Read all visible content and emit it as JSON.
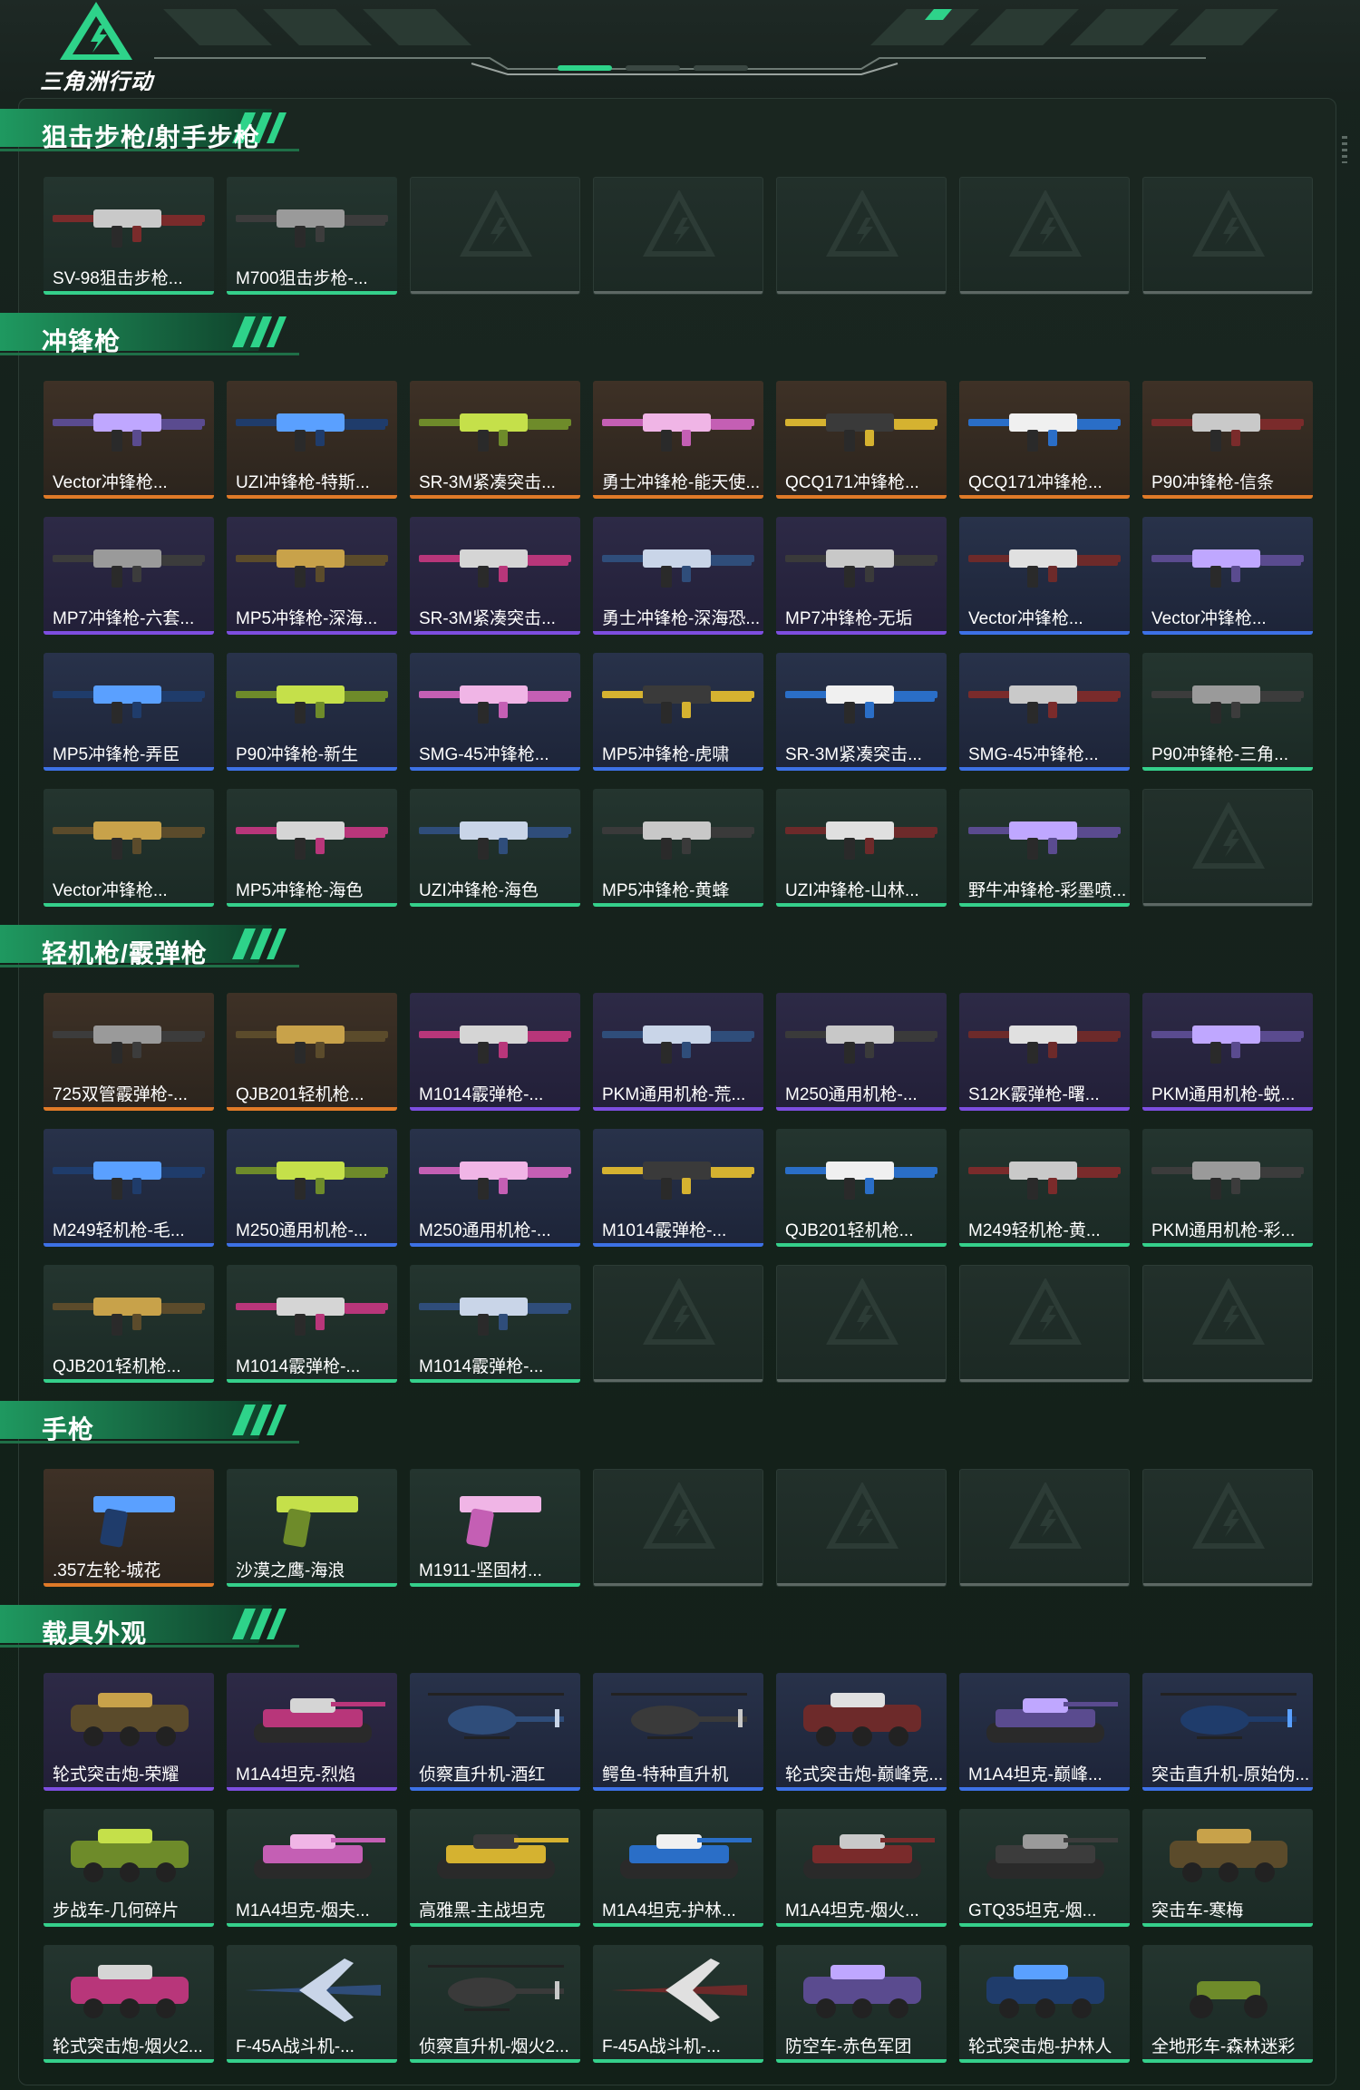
{
  "header": {
    "logo_text": "三角洲行动"
  },
  "colors": {
    "accent": "#35d08b",
    "orange": "#e07a28",
    "purple": "#7d4ee0",
    "blue": "#3d71e6",
    "green": "#35d08b"
  },
  "sections": [
    {
      "title": "狙击步枪/射手步枪",
      "items": [
        {
          "label": "SV-98狙击步枪...",
          "rarity": "green",
          "icon": "sniper-rifle-icon"
        },
        {
          "label": "M700狙击步枪-...",
          "rarity": "green",
          "icon": "sniper-rifle-icon"
        },
        {
          "label": "",
          "rarity": "empty"
        },
        {
          "label": "",
          "rarity": "empty"
        },
        {
          "label": "",
          "rarity": "empty"
        },
        {
          "label": "",
          "rarity": "empty"
        },
        {
          "label": "",
          "rarity": "empty"
        }
      ]
    },
    {
      "title": "冲锋枪",
      "items": [
        {
          "label": "Vector冲锋枪...",
          "rarity": "orange",
          "icon": "smg-icon"
        },
        {
          "label": "UZI冲锋枪-特斯...",
          "rarity": "orange",
          "icon": "smg-icon"
        },
        {
          "label": "SR-3M紧凑突击...",
          "rarity": "orange",
          "icon": "smg-icon"
        },
        {
          "label": "勇士冲锋枪-能天使...",
          "rarity": "orange",
          "icon": "smg-icon"
        },
        {
          "label": "QCQ171冲锋枪...",
          "rarity": "orange",
          "icon": "smg-icon"
        },
        {
          "label": "QCQ171冲锋枪...",
          "rarity": "orange",
          "icon": "smg-icon"
        },
        {
          "label": "P90冲锋枪-信条",
          "rarity": "orange",
          "icon": "smg-icon"
        },
        {
          "label": "MP7冲锋枪-六套...",
          "rarity": "purple",
          "icon": "smg-icon"
        },
        {
          "label": "MP5冲锋枪-深海...",
          "rarity": "purple",
          "icon": "smg-icon"
        },
        {
          "label": "SR-3M紧凑突击...",
          "rarity": "purple",
          "icon": "smg-icon"
        },
        {
          "label": "勇士冲锋枪-深海恐...",
          "rarity": "purple",
          "icon": "smg-icon"
        },
        {
          "label": "MP7冲锋枪-无垢",
          "rarity": "purple",
          "icon": "smg-icon"
        },
        {
          "label": "Vector冲锋枪...",
          "rarity": "blue",
          "icon": "smg-icon"
        },
        {
          "label": "Vector冲锋枪...",
          "rarity": "blue",
          "icon": "smg-icon"
        },
        {
          "label": "MP5冲锋枪-弄臣",
          "rarity": "blue",
          "icon": "smg-icon"
        },
        {
          "label": "P90冲锋枪-新生",
          "rarity": "blue",
          "icon": "smg-icon"
        },
        {
          "label": "SMG-45冲锋枪...",
          "rarity": "blue",
          "icon": "smg-icon"
        },
        {
          "label": "MP5冲锋枪-虎啸",
          "rarity": "blue",
          "icon": "smg-icon"
        },
        {
          "label": "SR-3M紧凑突击...",
          "rarity": "blue",
          "icon": "smg-icon"
        },
        {
          "label": "SMG-45冲锋枪...",
          "rarity": "blue",
          "icon": "smg-icon"
        },
        {
          "label": "P90冲锋枪-三角...",
          "rarity": "green",
          "icon": "smg-icon"
        },
        {
          "label": "Vector冲锋枪...",
          "rarity": "green",
          "icon": "smg-icon"
        },
        {
          "label": "MP5冲锋枪-海色",
          "rarity": "green",
          "icon": "smg-icon"
        },
        {
          "label": "UZI冲锋枪-海色",
          "rarity": "green",
          "icon": "smg-icon"
        },
        {
          "label": "MP5冲锋枪-黄蜂",
          "rarity": "green",
          "icon": "smg-icon"
        },
        {
          "label": "UZI冲锋枪-山林...",
          "rarity": "green",
          "icon": "smg-icon"
        },
        {
          "label": "野牛冲锋枪-彩墨喷...",
          "rarity": "green",
          "icon": "smg-icon"
        },
        {
          "label": "",
          "rarity": "empty"
        }
      ]
    },
    {
      "title": "轻机枪/霰弹枪",
      "items": [
        {
          "label": "725双管霰弹枪-...",
          "rarity": "orange",
          "icon": "shotgun-icon"
        },
        {
          "label": "QJB201轻机枪...",
          "rarity": "orange",
          "icon": "lmg-icon"
        },
        {
          "label": "M1014霰弹枪-...",
          "rarity": "purple",
          "icon": "shotgun-icon"
        },
        {
          "label": "PKM通用机枪-荒...",
          "rarity": "purple",
          "icon": "lmg-icon"
        },
        {
          "label": "M250通用机枪-...",
          "rarity": "purple",
          "icon": "lmg-icon"
        },
        {
          "label": "S12K霰弹枪-曙...",
          "rarity": "purple",
          "icon": "shotgun-icon"
        },
        {
          "label": "PKM通用机枪-蜕...",
          "rarity": "purple",
          "icon": "lmg-icon"
        },
        {
          "label": "M249轻机枪-毛...",
          "rarity": "blue",
          "icon": "lmg-icon"
        },
        {
          "label": "M250通用机枪-...",
          "rarity": "blue",
          "icon": "lmg-icon"
        },
        {
          "label": "M250通用机枪-...",
          "rarity": "blue",
          "icon": "lmg-icon"
        },
        {
          "label": "M1014霰弹枪-...",
          "rarity": "blue",
          "icon": "shotgun-icon"
        },
        {
          "label": "QJB201轻机枪...",
          "rarity": "green",
          "icon": "lmg-icon"
        },
        {
          "label": "M249轻机枪-黄...",
          "rarity": "green",
          "icon": "lmg-icon"
        },
        {
          "label": "PKM通用机枪-彩...",
          "rarity": "green",
          "icon": "lmg-icon"
        },
        {
          "label": "QJB201轻机枪...",
          "rarity": "green",
          "icon": "lmg-icon"
        },
        {
          "label": "M1014霰弹枪-...",
          "rarity": "green",
          "icon": "shotgun-icon"
        },
        {
          "label": "M1014霰弹枪-...",
          "rarity": "green",
          "icon": "shotgun-icon"
        },
        {
          "label": "",
          "rarity": "empty"
        },
        {
          "label": "",
          "rarity": "empty"
        },
        {
          "label": "",
          "rarity": "empty"
        },
        {
          "label": "",
          "rarity": "empty"
        }
      ]
    },
    {
      "title": "手枪",
      "items": [
        {
          "label": ".357左轮-城花",
          "rarity": "orange",
          "icon": "pistol-icon"
        },
        {
          "label": "沙漠之鹰-海浪",
          "rarity": "green",
          "icon": "pistol-icon"
        },
        {
          "label": "M1911-坚固材...",
          "rarity": "green",
          "icon": "pistol-icon"
        },
        {
          "label": "",
          "rarity": "empty"
        },
        {
          "label": "",
          "rarity": "empty"
        },
        {
          "label": "",
          "rarity": "empty"
        },
        {
          "label": "",
          "rarity": "empty"
        }
      ]
    },
    {
      "title": "载具外观",
      "items": [
        {
          "label": "轮式突击炮-荣耀",
          "rarity": "purple",
          "icon": "armored-car-icon"
        },
        {
          "label": "M1A4坦克-烈焰",
          "rarity": "purple",
          "icon": "tank-icon"
        },
        {
          "label": "侦察直升机-酒红",
          "rarity": "blue",
          "icon": "helicopter-icon"
        },
        {
          "label": "鳄鱼-特种直升机",
          "rarity": "blue",
          "icon": "helicopter-icon"
        },
        {
          "label": "轮式突击炮-巅峰竞...",
          "rarity": "blue",
          "icon": "armored-car-icon"
        },
        {
          "label": "M1A4坦克-巅峰...",
          "rarity": "blue",
          "icon": "tank-icon"
        },
        {
          "label": "突击直升机-原始伪...",
          "rarity": "blue",
          "icon": "helicopter-icon"
        },
        {
          "label": "步战车-几何碎片",
          "rarity": "green",
          "icon": "armored-car-icon"
        },
        {
          "label": "M1A4坦克-烟夫...",
          "rarity": "green",
          "icon": "tank-icon"
        },
        {
          "label": "高雅黑-主战坦克",
          "rarity": "green",
          "icon": "tank-icon"
        },
        {
          "label": "M1A4坦克-护林...",
          "rarity": "green",
          "icon": "tank-icon"
        },
        {
          "label": "M1A4坦克-烟火...",
          "rarity": "green",
          "icon": "tank-icon"
        },
        {
          "label": "GTQ35坦克-烟...",
          "rarity": "green",
          "icon": "tank-icon"
        },
        {
          "label": "突击车-寒梅",
          "rarity": "green",
          "icon": "armored-car-icon"
        },
        {
          "label": "轮式突击炮-烟火2...",
          "rarity": "green",
          "icon": "armored-car-icon"
        },
        {
          "label": "F-45A战斗机-...",
          "rarity": "green",
          "icon": "jet-icon"
        },
        {
          "label": "侦察直升机-烟火2...",
          "rarity": "green",
          "icon": "helicopter-icon"
        },
        {
          "label": "F-45A战斗机-...",
          "rarity": "green",
          "icon": "jet-icon"
        },
        {
          "label": "防空车-赤色军团",
          "rarity": "green",
          "icon": "armored-car-icon"
        },
        {
          "label": "轮式突击炮-护林人",
          "rarity": "green",
          "icon": "armored-car-icon"
        },
        {
          "label": "全地形车-森林迷彩",
          "rarity": "green",
          "icon": "atv-icon"
        }
      ]
    }
  ]
}
